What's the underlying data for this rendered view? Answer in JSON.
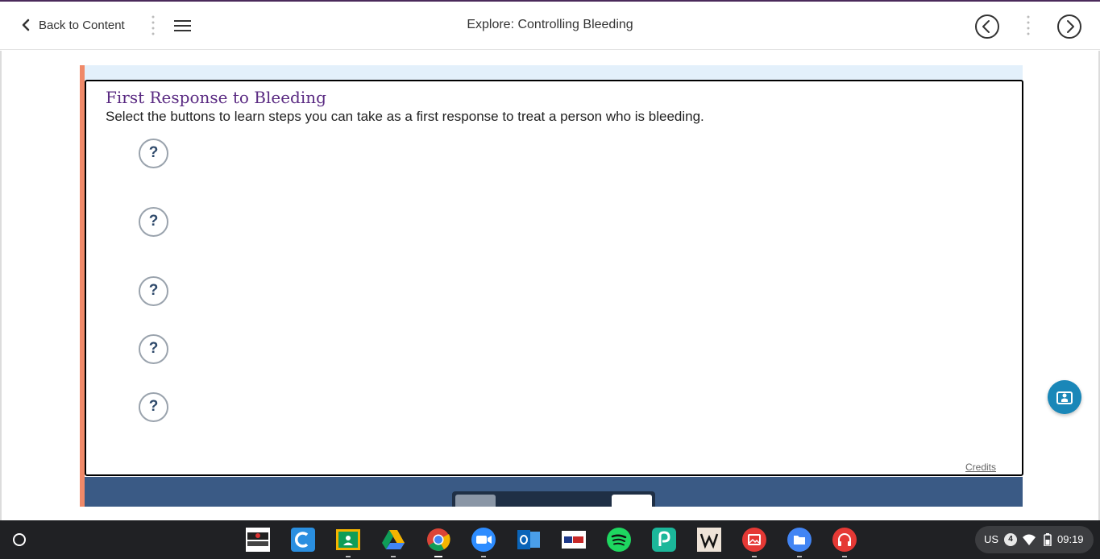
{
  "header": {
    "back_label": "Back to Content",
    "title": "Explore: Controlling Bleeding"
  },
  "card": {
    "title": "First Response to Bleeding",
    "subtitle": "Select the buttons to learn steps you can take as a first response to treat a person who is bleeding.",
    "hotspots": [
      "?",
      "?",
      "?",
      "?",
      "?"
    ],
    "credits": "Credits"
  },
  "shelf": {
    "apps": [
      "stop-bullying",
      "c-app",
      "google-classroom",
      "google-drive",
      "chrome",
      "zoom",
      "outlook",
      "wetip",
      "spotify",
      "app-green",
      "wikipedia",
      "gallery",
      "files",
      "headphones-app"
    ],
    "tray": {
      "locale": "US",
      "notifications": "4",
      "time": "09:19"
    }
  },
  "colors": {
    "accent_purple": "#5a2a82",
    "orange_bar": "#f08968",
    "navy": "#3a5a85",
    "fab": "#1a87b8"
  }
}
